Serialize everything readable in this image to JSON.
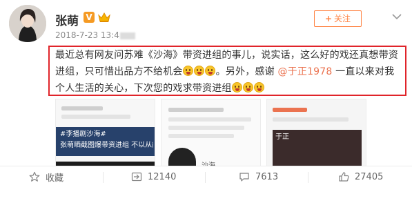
{
  "user": {
    "name": "张萌",
    "verified_badge": "V",
    "timestamp": "2018-7-23 13:4"
  },
  "header": {
    "follow_label": "关注",
    "follow_plus": "+"
  },
  "post": {
    "text_part1": "最近总有网友问苏难《沙海》带资进组的事儿，说实话，这么好的戏还真想带资进组，只可惜出品方不给机会",
    "text_part2": "。另外，感谢 ",
    "mention": "@于正1978",
    "text_part3": " 一直以来对我个人生活的关心，下次您的戏求带资进组"
  },
  "images": [
    {
      "caption_1": "#李播剧沙海#",
      "caption_2": "张萌晒截图爆带资进组 不以从前"
    },
    {
      "caption_1": "沙海",
      "caption_2": ""
    },
    {
      "caption_1": "于正",
      "caption_2": ""
    }
  ],
  "actions": {
    "favorite_label": "收藏",
    "repost_count": "12140",
    "comment_count": "7613",
    "like_count": "27405"
  },
  "colors": {
    "accent_orange": "#ff8140",
    "highlight_red": "#e0242a",
    "mention_color": "#eb7350"
  }
}
